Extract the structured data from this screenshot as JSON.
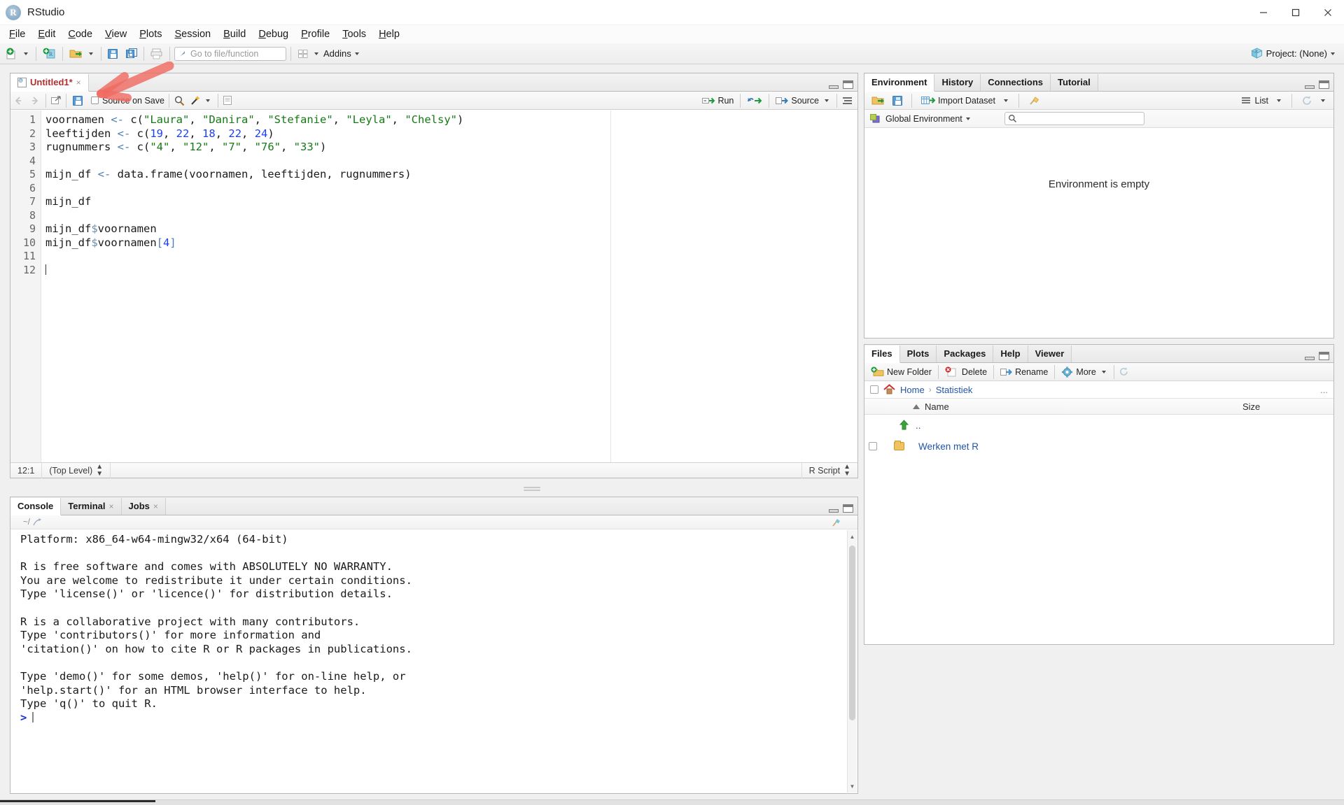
{
  "window": {
    "title": "RStudio",
    "app_icon": "R",
    "minimize": "–",
    "maximize": "❐",
    "close": "✕"
  },
  "menu": {
    "items": [
      "File",
      "Edit",
      "Code",
      "View",
      "Plots",
      "Session",
      "Build",
      "Debug",
      "Profile",
      "Tools",
      "Help"
    ]
  },
  "toolbar": {
    "new_file": "new-file-icon",
    "new_project": "new-project-icon",
    "open_file": "open-file-icon",
    "save": "save-icon",
    "save_all": "save-all-icon",
    "print": "print-icon",
    "goto_placeholder": "Go to file/function",
    "workspace_panes": "panes-icon",
    "addins_label": "Addins",
    "project_label": "Project: (None)"
  },
  "source": {
    "tab_label": "Untitled1*",
    "tab_close": "×",
    "back_icon": "back-arrow-icon",
    "forward_icon": "forward-arrow-icon",
    "popout_icon": "show-in-new-window-icon",
    "save_icon": "save-icon",
    "source_on_save_label": "Source on Save",
    "find_icon": "search-icon",
    "magic_icon": "code-tools-icon",
    "compile_icon": "compile-report-icon",
    "run_label": "Run",
    "rerun_icon": "rerun-icon",
    "source_label": "Source",
    "outline_icon": "document-outline-icon",
    "lines": [
      {
        "n": 1,
        "html": "voornamen <span class=\"s-op\">&lt;-</span> c(<span class=\"s-str\">\"Laura\"</span>, <span class=\"s-str\">\"Danira\"</span>, <span class=\"s-str\">\"Stefanie\"</span>, <span class=\"s-str\">\"Leyla\"</span>, <span class=\"s-str\">\"Chelsy\"</span>)"
      },
      {
        "n": 2,
        "html": "leeftijden <span class=\"s-op\">&lt;-</span> c(<span class=\"s-num\">19</span>, <span class=\"s-num\">22</span>, <span class=\"s-num\">18</span>, <span class=\"s-num\">22</span>, <span class=\"s-num\">24</span>)"
      },
      {
        "n": 3,
        "html": "rugnummers <span class=\"s-op\">&lt;-</span> c(<span class=\"s-str\">\"4\"</span>, <span class=\"s-str\">\"12\"</span>, <span class=\"s-str\">\"7\"</span>, <span class=\"s-str\">\"76\"</span>, <span class=\"s-str\">\"33\"</span>)"
      },
      {
        "n": 4,
        "html": ""
      },
      {
        "n": 5,
        "html": "mijn_df <span class=\"s-op\">&lt;-</span> data.frame(voornamen, leeftijden, rugnummers)"
      },
      {
        "n": 6,
        "html": ""
      },
      {
        "n": 7,
        "html": "mijn_df"
      },
      {
        "n": 8,
        "html": ""
      },
      {
        "n": 9,
        "html": "mijn_df<span class=\"s-dlr\">$</span>voornamen"
      },
      {
        "n": 10,
        "html": "mijn_df<span class=\"s-dlr\">$</span>voornamen<span class=\"s-brk\">[</span><span class=\"s-num\">4</span><span class=\"s-brk\">]</span>"
      },
      {
        "n": 11,
        "html": ""
      },
      {
        "n": 12,
        "html": "<span class=\"caretline\"></span>"
      }
    ],
    "status": {
      "cursor": "12:1",
      "scope": "(Top Level)",
      "file_type": "R Script"
    }
  },
  "console": {
    "tabs": [
      {
        "label": "Console",
        "closable": false,
        "active": true
      },
      {
        "label": "Terminal",
        "closable": true,
        "active": false
      },
      {
        "label": "Jobs",
        "closable": true,
        "active": false
      }
    ],
    "path": "~/",
    "path_popout_icon": "popout-icon",
    "clear_icon": "broom-icon",
    "output": "Platform: x86_64-w64-mingw32/x64 (64-bit)\n\nR is free software and comes with ABSOLUTELY NO WARRANTY.\nYou are welcome to redistribute it under certain conditions.\nType 'license()' or 'licence()' for distribution details.\n\nR is a collaborative project with many contributors.\nType 'contributors()' for more information and\n'citation()' on how to cite R or R packages in publications.\n\nType 'demo()' for some demos, 'help()' for on-line help, or\n'help.start()' for an HTML browser interface to help.\nType 'q()' to quit R.\n",
    "prompt": ">"
  },
  "environment": {
    "tabs": [
      "Environment",
      "History",
      "Connections",
      "Tutorial"
    ],
    "active_tab": "Environment",
    "load_icon": "open-workspace-icon",
    "save_icon": "save-workspace-icon",
    "import_label": "Import Dataset",
    "clear_icon": "broom-icon",
    "list_label": "List",
    "refresh_icon": "refresh-icon",
    "scope_label": "Global Environment",
    "search_placeholder": "",
    "empty_message": "Environment is empty"
  },
  "files": {
    "tabs": [
      "Files",
      "Plots",
      "Packages",
      "Help",
      "Viewer"
    ],
    "active_tab": "Files",
    "new_folder_label": "New Folder",
    "delete_label": "Delete",
    "rename_label": "Rename",
    "more_label": "More",
    "refresh_icon": "refresh-icon",
    "breadcrumb": {
      "home": "Home",
      "sep": "›",
      "current": "Statistiek",
      "overflow": "..."
    },
    "columns": {
      "name": "Name",
      "size": "Size",
      "sort_icon": "sort-asc-icon"
    },
    "rows": [
      {
        "icon": "up-folder-icon",
        "name": "..",
        "size": "",
        "has_checkbox": false
      },
      {
        "icon": "folder-icon",
        "name": "Werken met R",
        "size": "",
        "has_checkbox": true
      }
    ]
  },
  "annotation": {
    "arrow_color": "#ef6a61",
    "target": "save-icon"
  }
}
